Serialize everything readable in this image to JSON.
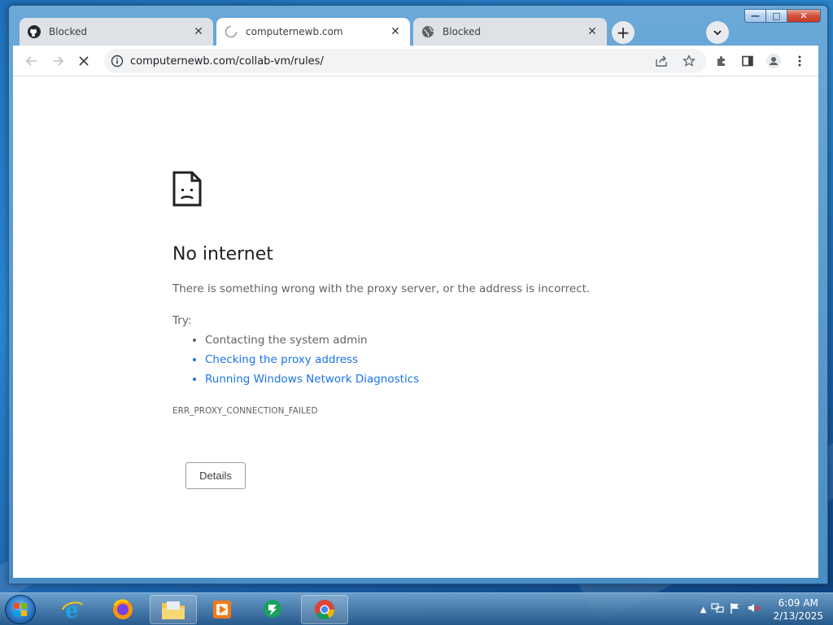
{
  "tabs": [
    {
      "title": "Blocked",
      "favicon": "github-icon",
      "active": false
    },
    {
      "title": "computernewb.com",
      "favicon": "loading-spinner-icon",
      "active": true
    },
    {
      "title": "Blocked",
      "favicon": "globe-icon",
      "active": false
    }
  ],
  "toolbar": {
    "url": "computernewb.com/collab-vm/rules/"
  },
  "page": {
    "heading": "No internet",
    "description": "There is something wrong with the proxy server, or the address is incorrect.",
    "try_label": "Try:",
    "suggestions": [
      {
        "text": "Contacting the system admin",
        "link": false
      },
      {
        "text": "Checking the proxy address",
        "link": true
      },
      {
        "text": "Running Windows Network Diagnostics",
        "link": true
      }
    ],
    "error_code": "ERR_PROXY_CONNECTION_FAILED",
    "details_button": "Details"
  },
  "taskbar": {
    "apps": [
      "internet-explorer-icon",
      "firefox-icon",
      "file-explorer-icon",
      "media-player-icon",
      "messenger-icon",
      "chrome-icon"
    ],
    "time": "6:09 AM",
    "date": "2/13/2025"
  },
  "colors": {
    "link": "#1a73e8",
    "text_secondary": "#5f6368",
    "heading": "#202124"
  }
}
